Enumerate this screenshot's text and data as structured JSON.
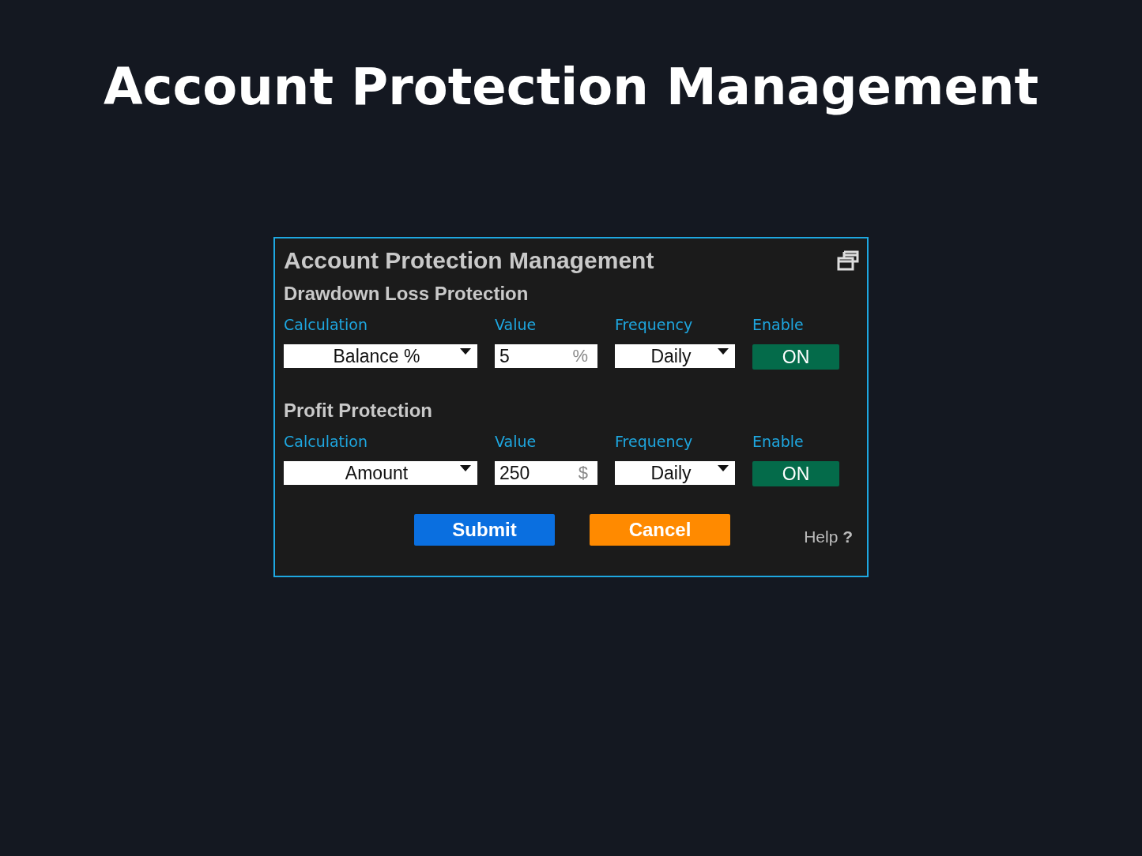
{
  "headline": "Account Protection Management",
  "dialog": {
    "title": "Account Protection Management",
    "sections": [
      {
        "title": "Drawdown Loss Protection",
        "headers": [
          "Calculation",
          "Value",
          "Frequency",
          "Enable"
        ],
        "calculation": "Balance %",
        "value": "5",
        "unit": "%",
        "frequency": "Daily",
        "enable": {
          "label": "ON",
          "on": true
        }
      },
      {
        "title": "Profit Protection",
        "headers": [
          "Calculation",
          "Value",
          "Frequency",
          "Enable"
        ],
        "calculation": "Amount",
        "value": "250",
        "unit": "$",
        "frequency": "Daily",
        "enable": {
          "label": "ON",
          "on": true
        }
      }
    ],
    "buttons": [
      {
        "label": "Submit",
        "kind": "primary"
      },
      {
        "label": "Cancel",
        "kind": "cancel"
      }
    ],
    "help": {
      "label": "Help",
      "mark": "?"
    }
  }
}
